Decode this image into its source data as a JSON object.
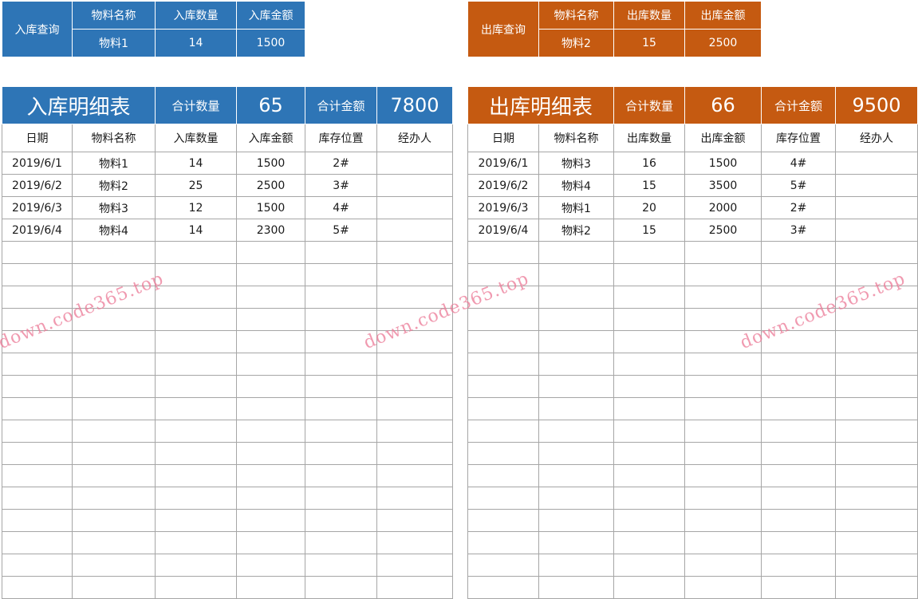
{
  "colors": {
    "inbound": "#2e75b6",
    "outbound": "#c55a11",
    "grid": "#a6a6a6",
    "watermark": "#eb7896"
  },
  "inbound_query": {
    "label": "入库查询",
    "headers": [
      "物料名称",
      "入库数量",
      "入库金额"
    ],
    "values": [
      "物料1",
      "14",
      "1500"
    ]
  },
  "outbound_query": {
    "label": "出库查询",
    "headers": [
      "物料名称",
      "出库数量",
      "出库金额"
    ],
    "values": [
      "物料2",
      "15",
      "2500"
    ]
  },
  "inbound_detail": {
    "title": "入库明细表",
    "total_qty_label": "合计数量",
    "total_qty": "65",
    "total_amount_label": "合计金额",
    "total_amount": "7800",
    "columns": [
      "日期",
      "物料名称",
      "入库数量",
      "入库金额",
      "库存位置",
      "经办人"
    ],
    "rows": [
      [
        "2019/6/1",
        "物料1",
        "14",
        "1500",
        "2#",
        ""
      ],
      [
        "2019/6/2",
        "物料2",
        "25",
        "2500",
        "3#",
        ""
      ],
      [
        "2019/6/3",
        "物料3",
        "12",
        "1500",
        "4#",
        ""
      ],
      [
        "2019/6/4",
        "物料4",
        "14",
        "2300",
        "5#",
        ""
      ]
    ]
  },
  "outbound_detail": {
    "title": "出库明细表",
    "total_qty_label": "合计数量",
    "total_qty": "66",
    "total_amount_label": "合计金额",
    "total_amount": "9500",
    "columns": [
      "日期",
      "物料名称",
      "出库数量",
      "出库金额",
      "库存位置",
      "经办人"
    ],
    "rows": [
      [
        "2019/6/1",
        "物料3",
        "16",
        "1500",
        "4#",
        ""
      ],
      [
        "2019/6/2",
        "物料4",
        "15",
        "3500",
        "5#",
        ""
      ],
      [
        "2019/6/3",
        "物料1",
        "20",
        "2000",
        "2#",
        ""
      ],
      [
        "2019/6/4",
        "物料2",
        "15",
        "2500",
        "3#",
        ""
      ]
    ]
  },
  "watermark": "down.code365.top"
}
